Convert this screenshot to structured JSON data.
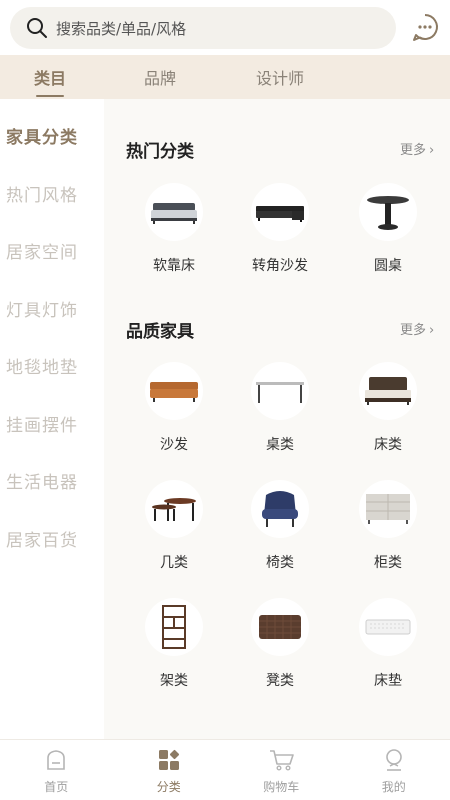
{
  "search": {
    "placeholder": "搜索品类/单品/风格"
  },
  "header": {
    "message_icon": "chat-bubble-icon"
  },
  "tabs": [
    {
      "label": "类目",
      "active": true
    },
    {
      "label": "品牌",
      "active": false
    },
    {
      "label": "设计师",
      "active": false
    }
  ],
  "sidebar": {
    "items": [
      {
        "label": "家具分类",
        "active": true
      },
      {
        "label": "热门风格"
      },
      {
        "label": "居家空间"
      },
      {
        "label": "灯具灯饰"
      },
      {
        "label": "地毯地垫"
      },
      {
        "label": "挂画摆件"
      },
      {
        "label": "生活电器"
      },
      {
        "label": "居家百货"
      }
    ]
  },
  "sections": [
    {
      "title": "热门分类",
      "more": "更多",
      "items": [
        {
          "label": "软靠床",
          "icon": "upholstered-bed-icon"
        },
        {
          "label": "转角沙发",
          "icon": "corner-sofa-icon"
        },
        {
          "label": "圆桌",
          "icon": "round-table-icon"
        }
      ]
    },
    {
      "title": "品质家具",
      "more": "更多",
      "items": [
        {
          "label": "沙发",
          "icon": "sofa-icon"
        },
        {
          "label": "桌类",
          "icon": "table-icon"
        },
        {
          "label": "床类",
          "icon": "bed-icon"
        },
        {
          "label": "几类",
          "icon": "nesting-tables-icon"
        },
        {
          "label": "椅类",
          "icon": "armchair-icon"
        },
        {
          "label": "柜类",
          "icon": "cabinet-icon"
        },
        {
          "label": "架类",
          "icon": "shelf-icon"
        },
        {
          "label": "凳类",
          "icon": "ottoman-icon"
        },
        {
          "label": "床垫",
          "icon": "mattress-icon"
        }
      ]
    }
  ],
  "bottom_nav": [
    {
      "label": "首页",
      "icon": "home-icon",
      "active": false
    },
    {
      "label": "分类",
      "icon": "category-icon",
      "active": true
    },
    {
      "label": "购物车",
      "icon": "cart-icon",
      "active": false
    },
    {
      "label": "我的",
      "icon": "profile-icon",
      "active": false
    }
  ],
  "colors": {
    "accent": "#8c7a63",
    "tab_bar_bg": "#f3ebe1",
    "content_bg": "#faf9f6",
    "inactive_text": "#c8c3bc"
  }
}
